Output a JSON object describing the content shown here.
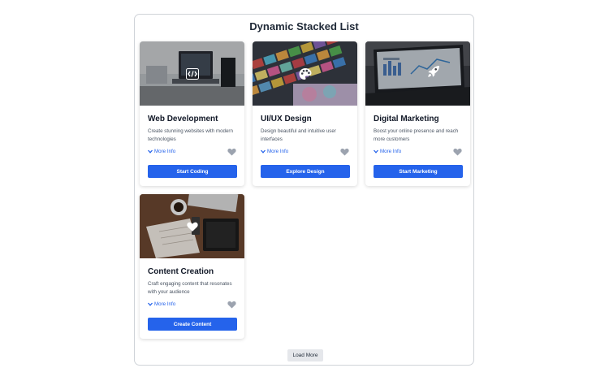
{
  "page": {
    "title": "Dynamic Stacked List"
  },
  "cards": [
    {
      "title": "Web Development",
      "description": "Create stunning websites with modern technologies",
      "more_info": "More Info",
      "cta": "Start Coding",
      "icon": "code-icon"
    },
    {
      "title": "UI/UX Design",
      "description": "Design beautiful and intuitive user interfaces",
      "more_info": "More Info",
      "cta": "Explore Design",
      "icon": "palette-icon"
    },
    {
      "title": "Digital Marketing",
      "description": "Boost your online presence and reach more customers",
      "more_info": "More Info",
      "cta": "Start Marketing",
      "icon": "rocket-icon"
    },
    {
      "title": "Content Creation",
      "description": "Craft engaging content that resonates with your audience",
      "more_info": "More Info",
      "cta": "Create Content",
      "icon": "heart-icon"
    }
  ],
  "load_more": "Load More",
  "colors": {
    "primary": "#2563eb",
    "heart": "#9ca3af",
    "load_more_bg": "#e5e7eb"
  }
}
